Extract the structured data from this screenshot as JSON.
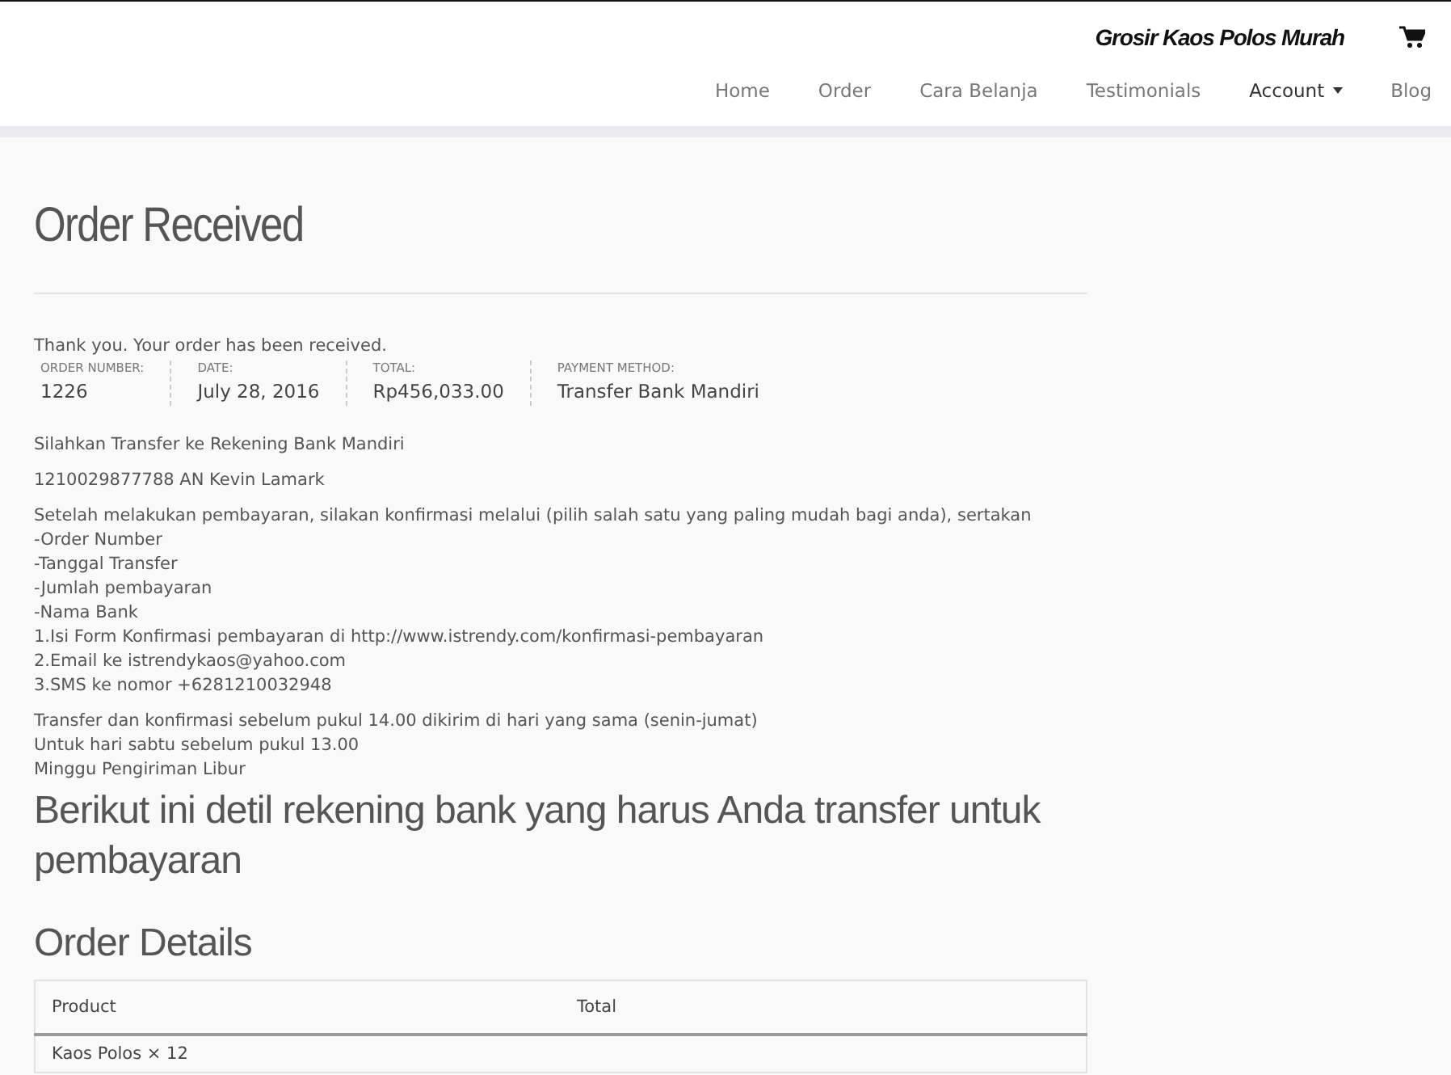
{
  "header": {
    "site_title": "Grosir Kaos Polos Murah"
  },
  "nav": [
    {
      "label": "Home",
      "kind": "link"
    },
    {
      "label": "Order",
      "kind": "link"
    },
    {
      "label": "Cara Belanja",
      "kind": "link"
    },
    {
      "label": "Testimonials",
      "kind": "link"
    },
    {
      "label": "Account",
      "kind": "dropdown"
    },
    {
      "label": "Blog",
      "kind": "link"
    }
  ],
  "page_title": "Order Received",
  "notice": "Thank you. Your order has been received.",
  "overview": [
    {
      "label": "ORDER NUMBER:",
      "value": "1226"
    },
    {
      "label": "DATE:",
      "value": "July 28, 2016"
    },
    {
      "label": "TOTAL:",
      "value": "Rp456,033.00"
    },
    {
      "label": "PAYMENT METHOD:",
      "value": "Transfer Bank Mandiri"
    }
  ],
  "paragraphs": [
    [
      "Silahkan Transfer ke Rekening Bank Mandiri"
    ],
    [
      "1210029877788 AN Kevin Lamark"
    ],
    [
      "Setelah melakukan pembayaran, silakan konfirmasi melalui (pilih salah satu yang paling mudah bagi anda), sertakan",
      "-Order Number",
      "-Tanggal Transfer",
      "-Jumlah pembayaran",
      "-Nama Bank",
      "1.Isi Form Konfirmasi pembayaran di http://www.istrendy.com/konfirmasi-pembayaran",
      "2.Email ke istrendykaos@yahoo.com",
      "3.SMS ke nomor +6281210032948"
    ],
    [
      "Transfer dan konfirmasi sebelum pukul 14.00 dikirim di hari yang sama (senin-jumat)",
      "Untuk hari sabtu sebelum pukul 13.00",
      "Minggu Pengiriman Libur"
    ]
  ],
  "bank_heading": "Berikut ini detil rekening bank yang harus Anda transfer untuk pembayaran",
  "details_heading": "Order Details",
  "table": {
    "columns": [
      "Product",
      "Total"
    ],
    "rows": [
      [
        "Kaos Polos × 12"
      ]
    ]
  }
}
